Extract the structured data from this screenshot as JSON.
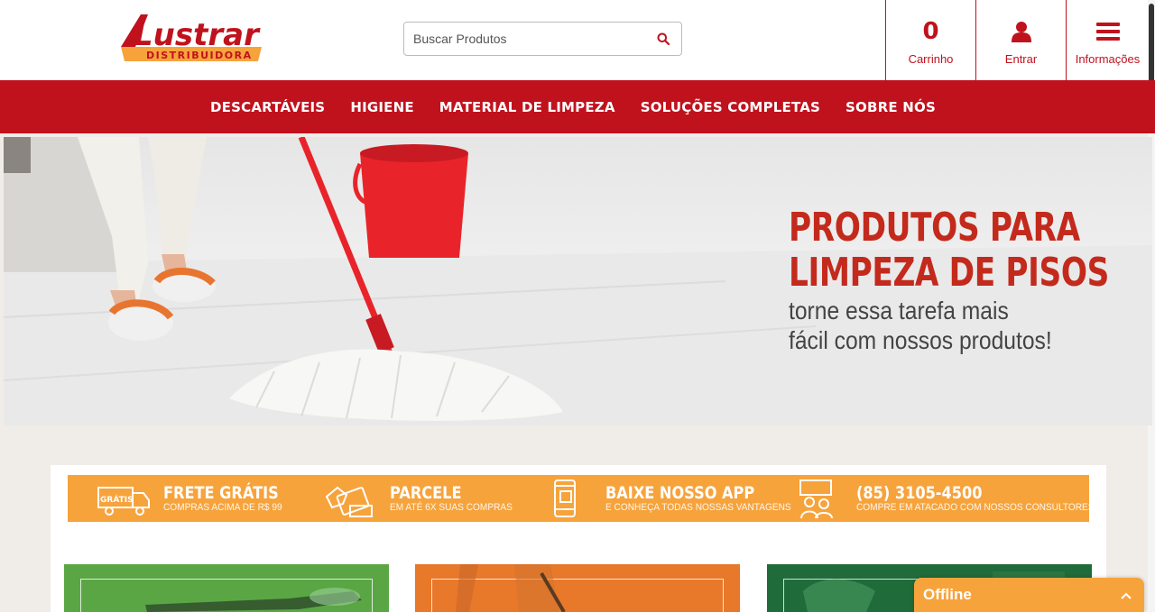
{
  "header": {
    "logo_text": "Lustrar",
    "logo_subtext": "DISTRIBUIDORA",
    "search_placeholder": "Buscar Produtos",
    "cart_count": "0",
    "cart_label": "Carrinho",
    "login_label": "Entrar",
    "info_label": "Informações"
  },
  "nav": {
    "items": [
      "DESCARTÁVEIS",
      "HIGIENE",
      "MATERIAL DE LIMPEZA",
      "SOLUÇÕES COMPLETAS",
      "SOBRE NÓS"
    ]
  },
  "banner": {
    "title_line1": "PRODUTOS PARA",
    "title_line2": "LIMPEZA DE PISOS",
    "sub_line1": "torne essa tarefa mais",
    "sub_line2": "fácil com nossos produtos!"
  },
  "features": [
    {
      "icon": "truck-icon",
      "badge": "GRÁTIS",
      "title": "FRETE GRÁTIS",
      "subtitle": "COMPRAS ACIMA DE R$ 99"
    },
    {
      "icon": "card-payment-icon",
      "title": "PARCELE",
      "subtitle": "EM ATÉ 6X SUAS COMPRAS"
    },
    {
      "icon": "phone-app-icon",
      "title": "BAIXE NOSSO APP",
      "subtitle": "E CONHEÇA TODAS NOSSAS VANTAGENS"
    },
    {
      "icon": "consultant-icon",
      "title": "(85) 3105-4500",
      "subtitle": "COMPRE EM ATACADO COM NOSSOS CONSULTORES"
    }
  ],
  "chat": {
    "status_label": "Offline"
  },
  "colors": {
    "brand_red": "#c0121d",
    "brand_orange": "#f7a33c",
    "card_green": "#5aa645",
    "card_orange": "#e8782a",
    "card_dark_green": "#1f6b3a"
  }
}
